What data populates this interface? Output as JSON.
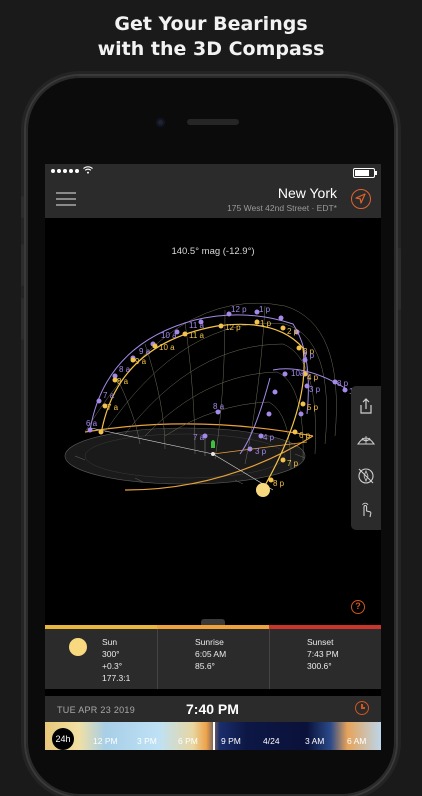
{
  "headline": {
    "line1": "Get Your Bearings",
    "line2": "with the 3D Compass"
  },
  "location": {
    "city": "New York",
    "address": "175 West 42nd Street · EDT*"
  },
  "compass": {
    "bearing": "140.5° mag (-12.9°)",
    "sun_path_labels": [
      "6 a",
      "7 a",
      "8 a",
      "9 a",
      "10 a",
      "11 a",
      "12 p",
      "1 p",
      "2 p",
      "3 p",
      "4 p",
      "5 p",
      "6 p",
      "7 p"
    ],
    "moon_path_labels": [
      "6 a",
      "7 a",
      "8 a",
      "9 a",
      "10 a",
      "11 a",
      "12 p",
      "1 p",
      "2 p",
      "3 p",
      "4 p",
      "5 p",
      "6 p",
      "7 p",
      "8 p",
      "1 a"
    ]
  },
  "info": {
    "sun": {
      "label": "Sun",
      "azimuth": "300°",
      "altitude": "+0.3°",
      "extra": "177.3:1"
    },
    "sunrise": {
      "label": "Sunrise",
      "time": "6:05 AM",
      "azimuth": "85.6°"
    },
    "sunset": {
      "label": "Sunset",
      "time": "7:43 PM",
      "azimuth": "300.6°"
    }
  },
  "timeline": {
    "date": "TUE APR 23 2019",
    "time": "7:40 PM",
    "range": "24h",
    "ticks": [
      "12 PM",
      "3 PM",
      "6 PM",
      "9 PM",
      "4/24",
      "3 AM",
      "6 AM"
    ]
  },
  "colors": {
    "accent": "#e0632b",
    "sun_bar": "#e8b63a",
    "sunrise_bar": "#f0a23a",
    "sunset_bar": "#c9352a"
  },
  "icons": [
    "menu-icon",
    "location-arrow-icon",
    "share-icon",
    "dome-icon",
    "compass-off-icon",
    "touch-icon",
    "help-icon",
    "clock-icon"
  ]
}
